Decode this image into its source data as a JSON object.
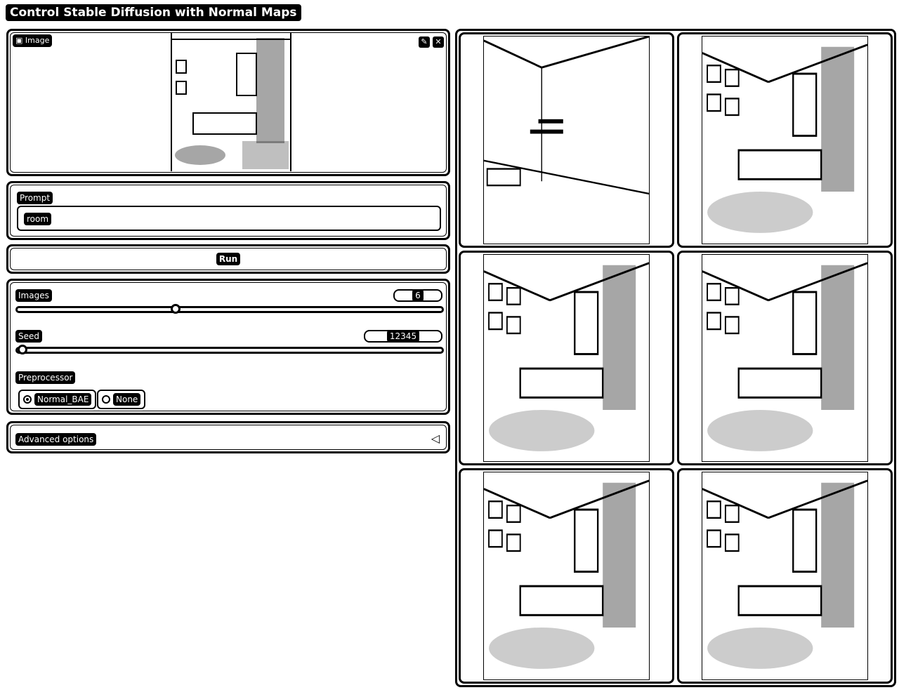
{
  "app": {
    "title": "Control Stable Diffusion with Normal Maps"
  },
  "image_input": {
    "label": "Image",
    "tools": [
      "edit-icon",
      "close-icon"
    ]
  },
  "prompt": {
    "label": "Prompt",
    "value": "room"
  },
  "run": {
    "label": "Run"
  },
  "images_setting": {
    "label": "Images",
    "value": "6",
    "fraction": 0.37
  },
  "seed_setting": {
    "label": "Seed",
    "value": "12345",
    "fraction": 0.0
  },
  "preprocessor": {
    "label": "Preprocessor",
    "options": [
      "Normal_BAE",
      "None"
    ],
    "selected": "Normal_BAE"
  },
  "advanced": {
    "label": "Advanced options",
    "icon": "triangle-left-icon"
  },
  "gallery": {
    "count": 6
  }
}
